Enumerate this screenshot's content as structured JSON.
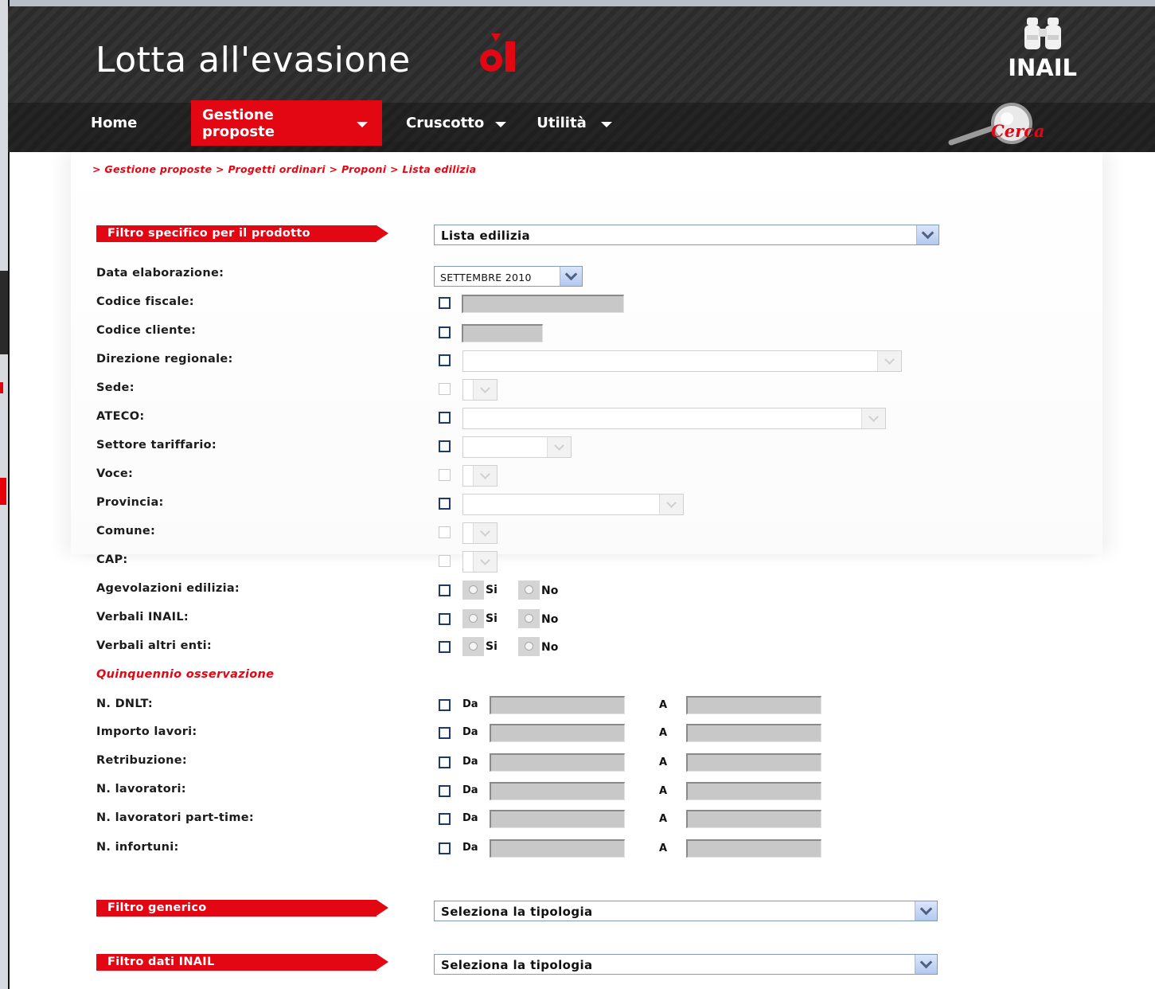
{
  "app": {
    "title": "Lotta all'evasione",
    "brand": "INAIL",
    "search_label": "Cerca"
  },
  "colors": {
    "accent": "#e30613",
    "header_bg": "#2b2b2b",
    "input_disabled": "#c8c8c8"
  },
  "nav": [
    {
      "label": "Home",
      "has_menu": false,
      "active": false
    },
    {
      "label": "Gestione proposte",
      "has_menu": true,
      "active": true
    },
    {
      "label": "Cruscotto",
      "has_menu": true,
      "active": false
    },
    {
      "label": "Utilità",
      "has_menu": true,
      "active": false
    }
  ],
  "breadcrumb": "> Gestione proposte > Progetti ordinari > Proponi > Lista edilizia",
  "filters": {
    "product": {
      "label": "Filtro specifico per il prodotto",
      "value": "Lista edilizia"
    },
    "generic": {
      "label": "Filtro generico",
      "value": "Seleziona la tipologia"
    },
    "inail": {
      "label": "Filtro dati INAIL",
      "value": "Seleziona la tipologia"
    }
  },
  "form": {
    "data_elaborazione": {
      "label": "Data elaborazione:",
      "value": "SETTEMBRE 2010"
    },
    "codice_fiscale": "Codice fiscale:",
    "codice_cliente": "Codice cliente:",
    "direzione_regionale": "Direzione regionale:",
    "sede": "Sede:",
    "ateco": "ATECO:",
    "settore_tariffario": "Settore tariffario:",
    "voce": "Voce:",
    "provincia": "Provincia:",
    "comune": "Comune:",
    "cap": "CAP:",
    "agevolazioni": "Agevolazioni edilizia:",
    "verbali_inail": "Verbali INAIL:",
    "verbali_altri": "Verbali altri enti:",
    "section_title": "Quinquennio osservazione",
    "n_dnlt": "N. DNLT:",
    "importo_lavori": "Importo lavori:",
    "retribuzione": "Retribuzione:",
    "n_lavoratori": "N. lavoratori:",
    "n_lavoratori_pt": "N. lavoratori part-time:",
    "n_infortuni": "N. infortuni:",
    "opt_si": "Si",
    "opt_no": "No",
    "da": "Da",
    "a": "A"
  }
}
